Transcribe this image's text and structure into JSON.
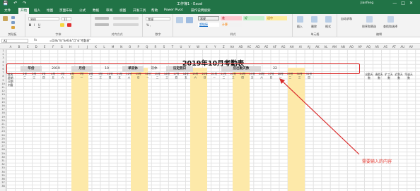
{
  "window": {
    "title": "工作簿1 - Excel",
    "user": "Jianfeng",
    "controls": [
      "—",
      "□",
      "✕"
    ]
  },
  "tabs": [
    "文件",
    "开始",
    "插入",
    "绘图",
    "页面布局",
    "公式",
    "数据",
    "审阅",
    "视图",
    "开发工具",
    "帮助",
    "Power Pivot",
    "操作说明搜索"
  ],
  "ribbon": {
    "font_name": "宋体",
    "font_size": "11",
    "groups": [
      "剪贴板",
      "字体",
      "对齐方式",
      "数字",
      "样式",
      "单元格",
      "编辑"
    ],
    "number_format": "常规",
    "styles": [
      "常规",
      "差",
      "好",
      "适中",
      "超链接",
      "计算"
    ],
    "cell_buttons": [
      "插入",
      "删除",
      "格式"
    ],
    "edit_buttons": [
      "自动求和",
      "排序和筛选",
      "查找和选择"
    ]
  },
  "formula_bar": {
    "name_box": "A1",
    "fx": "fx",
    "formula": "=D3&\"年\"&H3&\"月\"&\"考勤表\""
  },
  "columns": [
    "A",
    "B",
    "C",
    "D",
    "E",
    "F",
    "G",
    "H",
    "I",
    "J",
    "K",
    "L",
    "M",
    "N",
    "O",
    "P",
    "Q",
    "R",
    "S",
    "T",
    "U",
    "V",
    "W",
    "X",
    "Y",
    "Z",
    "AA",
    "AB",
    "AC",
    "AD",
    "AE",
    "AF",
    "AG",
    "AH",
    "AI",
    "AJ",
    "AK",
    "AL",
    "AM",
    "AN",
    "AO",
    "AP",
    "AQ",
    "AR",
    "AS",
    "AT",
    "AU",
    "AV"
  ],
  "rows": [
    "1",
    "2",
    "3",
    "4",
    "5",
    "6",
    "7",
    "8",
    "9",
    "10",
    "11",
    "12",
    "13",
    "14",
    "15",
    "16",
    "17",
    "18",
    "19",
    "20",
    "21",
    "22",
    "23",
    "24",
    "25",
    "26",
    "27",
    "28",
    "29",
    "30",
    "31",
    "32",
    "33",
    "34",
    "35",
    "36",
    "37",
    "38"
  ],
  "sheet": {
    "title": "2019年10月考勤表",
    "info": [
      {
        "label": "年份",
        "value": "2019"
      },
      {
        "label": "月份",
        "value": "10"
      },
      {
        "label": "单双休",
        "value": "双休"
      },
      {
        "label": "法定假日",
        "value": ""
      },
      {
        "label": "应出勤天数",
        "value": "22"
      }
    ],
    "row_labels": {
      "r3": "姓名",
      "r4": "星期",
      "r5": "日期",
      "r6": "刘备"
    },
    "dates": [
      "1号",
      "2号",
      "3号",
      "4号",
      "5号",
      "6号",
      "7号",
      "8号",
      "9号",
      "10号",
      "11号",
      "12号",
      "13号",
      "14号",
      "15号",
      "16号",
      "17号",
      "18号",
      "19号",
      "20号",
      "21号",
      "22号",
      "23号",
      "24号",
      "25号",
      "26号",
      "27号",
      "28号",
      "29号",
      "30号",
      "31号"
    ],
    "weekdays": [
      "二",
      "三",
      "四",
      "五",
      "六",
      "日",
      "一",
      "二",
      "三",
      "四",
      "五",
      "六",
      "日",
      "一",
      "二",
      "三",
      "四",
      "五",
      "六",
      "日",
      "一",
      "二",
      "三",
      "四",
      "五",
      "六",
      "日",
      "一",
      "二",
      "三",
      "四"
    ],
    "stats": [
      "出勤天数",
      "请假天数",
      "旷工天数",
      "迟到天数",
      "早退天数"
    ]
  },
  "annotation": "需要输入的内容",
  "colors": {
    "excel_green": "#217346",
    "weekend_yellow": "#fde9a9",
    "red": "#d92a2a",
    "style_bad": "#ffc7ce",
    "style_good": "#c6efce",
    "style_neutral": "#ffeb9c"
  }
}
